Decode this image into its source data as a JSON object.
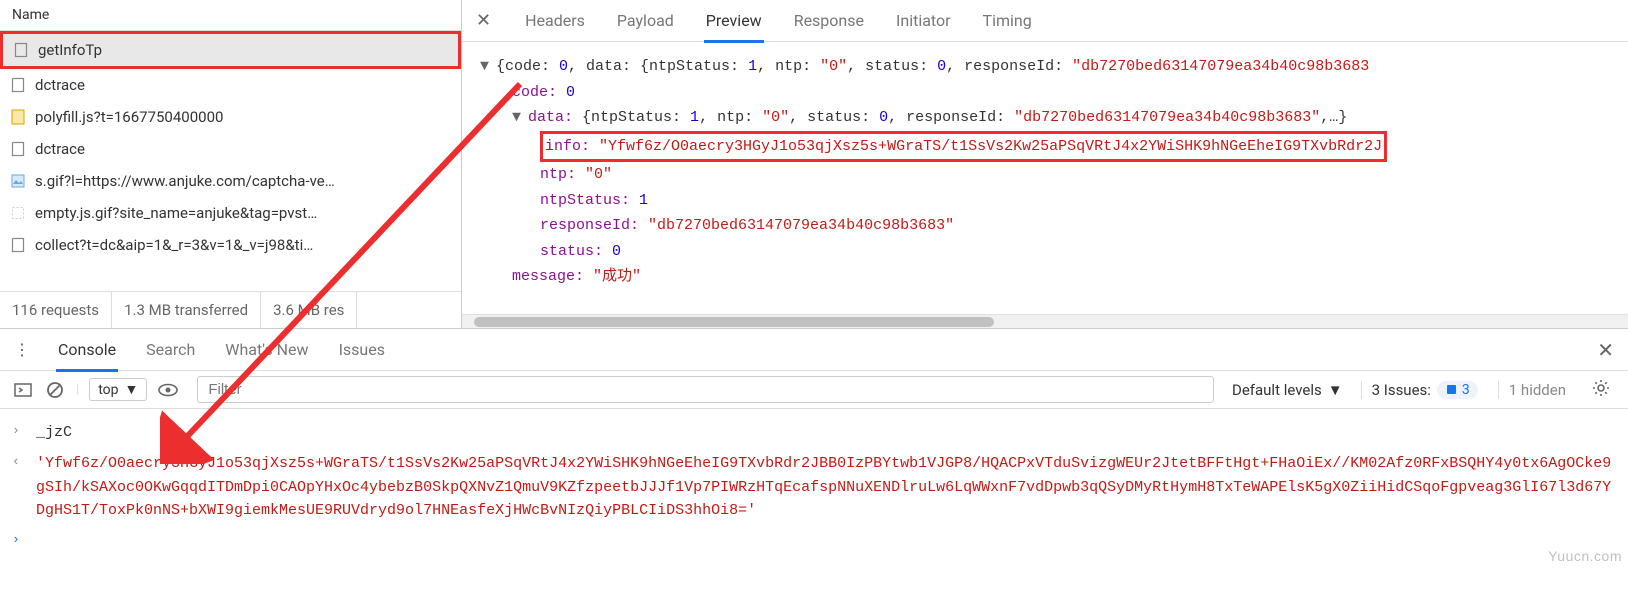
{
  "network": {
    "column_header": "Name",
    "requests": [
      {
        "name": "getInfoTp",
        "icon": "doc"
      },
      {
        "name": "dctrace",
        "icon": "doc"
      },
      {
        "name": "polyfill.js?t=1667750400000",
        "icon": "js"
      },
      {
        "name": "dctrace",
        "icon": "doc"
      },
      {
        "name": "s.gif?l=https://www.anjuke.com/captcha-ve…",
        "icon": "img"
      },
      {
        "name": "empty.js.gif?site_name=anjuke&tag=pvst…",
        "icon": "blank"
      },
      {
        "name": "collect?t=dc&aip=1&_r=3&v=1&_v=j98&ti…",
        "icon": "doc"
      }
    ],
    "status": {
      "requests": "116 requests",
      "transferred": "1.3 MB transferred",
      "resources": "3.6 MB res"
    }
  },
  "preview": {
    "tabs": [
      "Headers",
      "Payload",
      "Preview",
      "Response",
      "Initiator",
      "Timing"
    ],
    "active_tab": 2,
    "json": {
      "line1_prefix": "{code: ",
      "code": "0",
      "line1_mid": ", data: {ntpStatus: ",
      "ntpStatus": "1",
      "line1_ntp": ", ntp: ",
      "ntp_val": "\"0\"",
      "line1_status": ", status: ",
      "status_val": "0",
      "line1_resp": ", responseId: ",
      "responseId_short": "\"db7270bed63147079ea34b40c98b3683",
      "row_code_k": "code: ",
      "row_code_v": "0",
      "row_data": "data: {ntpStatus: 1, ntp: \"0\", status: 0, responseId: \"db7270bed63147079ea34b40c98b3683\",…}",
      "row_info_k": "info: ",
      "row_info_v": "\"Yfwf6z/O0aecry3HGyJ1o53qjXsz5s+WGraTS/t1SsVs2Kw25aPSqVRtJ4x2YWiSHK9hNGeEheIG9TXvbRdr2J",
      "row_ntp_k": "ntp: ",
      "row_ntp_v": "\"0\"",
      "row_ntps_k": "ntpStatus: ",
      "row_ntps_v": "1",
      "row_rid_k": "responseId: ",
      "row_rid_v": "\"db7270bed63147079ea34b40c98b3683\"",
      "row_status_k": "status: ",
      "row_status_v": "0",
      "row_msg_k": "message: ",
      "row_msg_v": "\"成功\""
    }
  },
  "drawer": {
    "tabs": [
      "Console",
      "Search",
      "What's New",
      "Issues"
    ],
    "active_tab": 0,
    "context": "top",
    "filter_placeholder": "Filter",
    "levels": "Default levels",
    "issues_label": "3 Issues:",
    "issues_count": "3",
    "hidden_label": "1 hidden"
  },
  "console": {
    "input": "_jzC",
    "output": "'Yfwf6z/O0aecry3HGyJ1o53qjXsz5s+WGraTS/t1SsVs2Kw25aPSqVRtJ4x2YWiSHK9hNGeEheIG9TXvbRdr2JBB0IzPBYtwb1VJGP8/HQACPxVTduSvizgWEUr2JtetBFFtHgt+FHaOiEx//KM02Afz0RFxBSQHY4y0tx6AgOCke9gSIh/kSAXoc0OKwGqqdITDmDpi0CAOpYHxOc4ybebzB0SkpQXNvZ1QmuV9KZfzpeetbJJJf1Vp7PIWRzHTqEcafspNNuXENDlruLw6LqWWxnF7vdDpwb3qQSyDMyRtHymH8TxTeWAPElsK5gX0ZiiHidCSqoFgpveag3GlI67l3d67YDgHS1T/ToxPk0nNS+bXWI9giemkMesUE9RUVdryd9ol7HNEasfeXjHWcBvNIzQiyPBLCIiDS3hhOi8='"
  },
  "watermark": "Yuucn.com"
}
